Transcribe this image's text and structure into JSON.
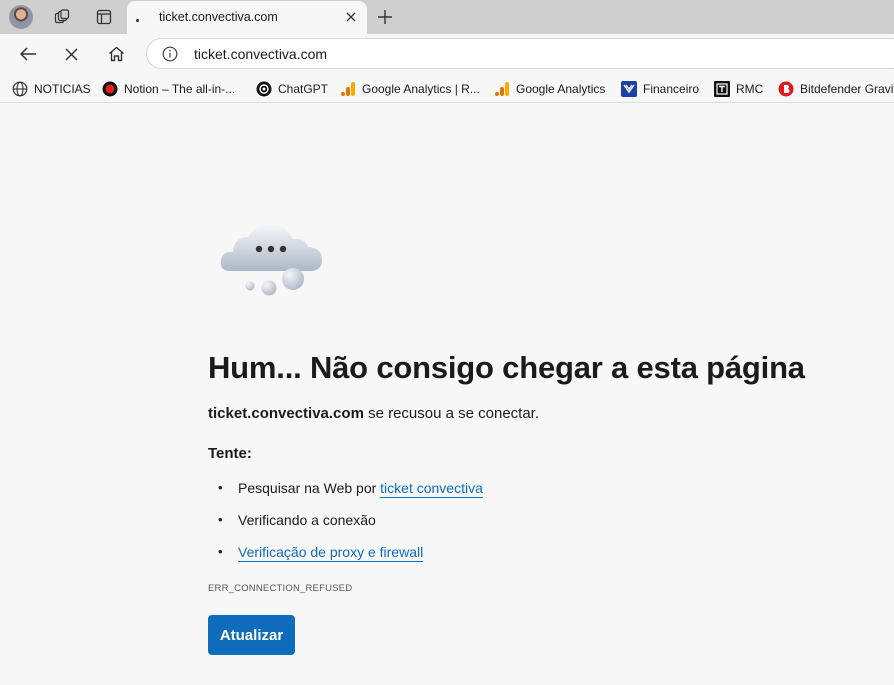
{
  "tab": {
    "title": "ticket.convectiva.com"
  },
  "address_bar": {
    "url": "ticket.convectiva.com"
  },
  "bookmarks": [
    {
      "label": "NOTICIAS",
      "icon": "globe-icon"
    },
    {
      "label": "Notion – The all-in-...",
      "icon": "notion-icon"
    },
    {
      "label": "ChatGPT",
      "icon": "chatgpt-icon"
    },
    {
      "label": "Google Analytics | R...",
      "icon": "google-analytics-icon"
    },
    {
      "label": "Google Analytics",
      "icon": "google-analytics-icon"
    },
    {
      "label": "Financeiro",
      "icon": "financeiro-icon"
    },
    {
      "label": "RMC",
      "icon": "rmc-icon"
    },
    {
      "label": "Bitdefender Gravit",
      "icon": "bitdefender-icon"
    }
  ],
  "error_page": {
    "heading": "Hum... Não consigo chegar a esta página",
    "host": "ticket.convectiva.com",
    "subtitle_rest": " se recusou a se conectar.",
    "try_label": "Tente:",
    "suggestions": [
      {
        "prefix": "Pesquisar na Web por ",
        "link": "ticket convectiva"
      },
      {
        "prefix": "Verificando a conexão",
        "link": ""
      },
      {
        "prefix": "",
        "link": "Verificação de proxy e firewall"
      }
    ],
    "error_code": "ERR_CONNECTION_REFUSED",
    "refresh_button": "Atualizar"
  },
  "colors": {
    "accent": "#0f6cbd",
    "tabstrip": "#cfcfcf",
    "page_bg": "#f7f7f7"
  }
}
